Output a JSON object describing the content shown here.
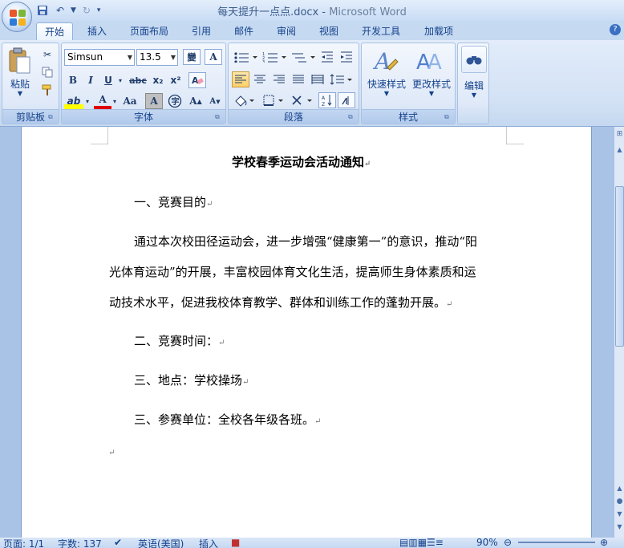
{
  "window": {
    "doc_name": "每天提升一点点.docx",
    "separator": " - ",
    "app_name": "Microsoft Word"
  },
  "tabs": [
    {
      "label": "开始"
    },
    {
      "label": "插入"
    },
    {
      "label": "页面布局"
    },
    {
      "label": "引用"
    },
    {
      "label": "邮件"
    },
    {
      "label": "审阅"
    },
    {
      "label": "视图"
    },
    {
      "label": "开发工具"
    },
    {
      "label": "加载项"
    }
  ],
  "ribbon": {
    "clipboard": {
      "paste_label": "粘贴",
      "group_label": "剪贴板"
    },
    "font": {
      "font_name": "Simsun",
      "font_size": "13.5",
      "group_label": "字体",
      "bold": "B",
      "italic": "I",
      "underline": "U",
      "strike": "abc",
      "subscript": "x₂",
      "superscript": "x²",
      "grow": "A",
      "shrink": "A",
      "case": "Aa",
      "char_shade": "A",
      "highlight_label": "ab",
      "font_color_label": "A",
      "phonetic": "變",
      "clear": "A"
    },
    "paragraph": {
      "group_label": "段落"
    },
    "styles": {
      "quick_styles": "快速样式",
      "change_styles": "更改样式",
      "group_label": "样式"
    },
    "editing": {
      "label": "编辑"
    }
  },
  "document": {
    "title": "学校春季运动会活动通知",
    "lines": [
      "一、竞赛目的",
      "通过本次校田径运动会，进一步增强“健康第一”的意识，推动“阳",
      "光体育运动”的开展，丰富校园体育文化生活，提高师生身体素质和运",
      "动技术水平，促进我校体育教学、群体和训练工作的蓬勃开展。",
      "二、竞赛时间：",
      "三、地点：学校操场",
      "三、参赛单位：全校各年级各班。"
    ],
    "para_mark": "↵"
  },
  "status": {
    "page": "页面: 1/1",
    "words": "字数: 137",
    "language": "英语(美国)",
    "mode": "插入",
    "zoom": "90%"
  },
  "colors": {
    "accent": "#15428b",
    "ribbon_bg": "#d3e2f5",
    "doc_bg": "#a9c3e6"
  }
}
